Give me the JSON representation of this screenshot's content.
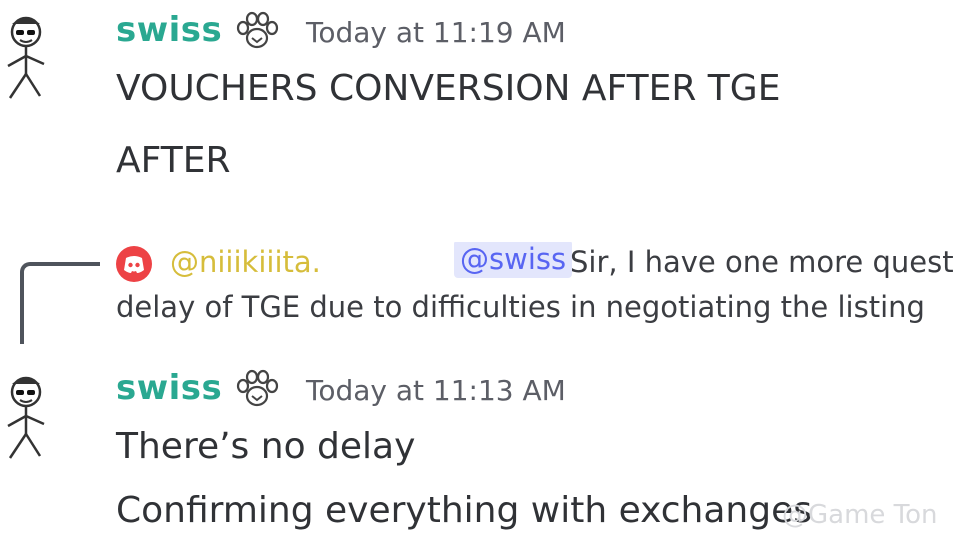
{
  "messages": [
    {
      "author": "swiss",
      "timestamp": "Today at 11:19 AM",
      "lines": [
        "VOUCHERS CONVERSION AFTER TGE",
        "AFTER"
      ]
    },
    {
      "reply": {
        "user": "@niiikiiita.",
        "mention": "@swiss",
        "text": "Sir, I have one more question. Is the",
        "text_line2": "delay of TGE due to difficulties in negotiating the listing"
      },
      "author": "swiss",
      "timestamp": "Today at 11:13 AM",
      "lines": [
        "There’s no delay",
        "Confirming everything with exchanges"
      ]
    }
  ],
  "watermark": "@Game Ton",
  "colors": {
    "author": "#2aa891",
    "reply_user": "#d6bd3b",
    "mention": "#5865f2",
    "mention_bg": "#e3e6fc",
    "reply_icon": "#ed4245"
  },
  "icons": [
    "stick-figure-avatar-icon",
    "paw-print-badge-icon",
    "discord-logo-icon",
    "reply-spine-icon"
  ]
}
